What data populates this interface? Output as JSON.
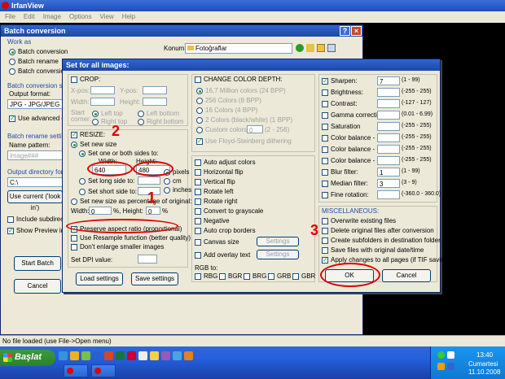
{
  "irfanview": {
    "title": "IrfanView",
    "menu": [
      "File",
      "Edit",
      "Image",
      "Options",
      "View",
      "Help"
    ],
    "status": "No file loaded (use File->Open menu)"
  },
  "batch": {
    "title": "Batch conversion",
    "work_as_label": "Work as",
    "work_as_options": [
      "Batch conversion",
      "Batch rename",
      "Batch conversion -"
    ],
    "settings_label": "Batch conversion setti",
    "output_format_label": "Output format:",
    "output_format_value": "JPG - JPG/JPEG Form",
    "use_advanced_label": "Use advanced optio",
    "rename_settings_label": "Batch rename settings",
    "name_pattern_label": "Name pattern:",
    "name_pattern_value": "image###",
    "output_dir_label": "Output directory for resu",
    "output_dir_value": "C:\\",
    "use_current_label": "Use current ('look in')",
    "include_subdirs_label": "Include subdirectories",
    "show_preview_label": "Show Preview imag",
    "start_batch_label": "Start Batch",
    "cancel_label": "Cancel",
    "konum_label": "Konum:",
    "konum_value": "Fotoğraflar"
  },
  "dialog": {
    "title": "Set for all images:",
    "crop": {
      "label": "CROP:",
      "xpos": "X-pos:",
      "ypos": "Y-pos:",
      "width": "Width:",
      "height": "Height:",
      "start_corner": "Start corner:",
      "corners": [
        "Left top",
        "Left bottom",
        "Right top",
        "Right bottom"
      ]
    },
    "resize": {
      "label": "RESIZE:",
      "set_new_size": "Set new size",
      "set_one_or_both": "Set one or both sides to:",
      "width_label": "Width:",
      "height_label": "Height:",
      "width_value": "640",
      "height_value": "480",
      "units": [
        "pixels",
        "cm",
        "inches"
      ],
      "set_long_side": "Set long side to:",
      "set_short_side": "Set short side to:",
      "set_as_percentage": "Set new size as percentage of original:",
      "pct_width_label": "Width:",
      "pct_height_label": "%, Height:",
      "pct_width_value": "0",
      "pct_height_value": "0",
      "pct_symbol": "%",
      "preserve_aspect": "Preserve aspect ratio (proportional)",
      "use_resample": "Use Resample function (better quality)",
      "dont_enlarge": "Don't enlarge smaller images",
      "set_dpi": "Set DPI value:"
    },
    "load_settings": "Load settings",
    "save_settings": "Save settings",
    "color_depth": {
      "label": "CHANGE COLOR DEPTH:",
      "options": [
        "16,7 Million colors (24 BPP)",
        "256 Colors (8 BPP)",
        "16 Colors (4 BPP)",
        "2 Colors (black/white) (1 BPP)",
        "Custom colors:"
      ],
      "custom_range": "(2 - 256)",
      "custom_value": "0",
      "floyd": "Use Floyd-Steinberg dithering"
    },
    "transforms": [
      "Auto adjust colors",
      "Horizontal flip",
      "Vertical flip",
      "Rotate left",
      "Rotate right",
      "Convert to grayscale",
      "Negative",
      "Auto crop borders",
      "Canvas size",
      "Add overlay text"
    ],
    "settings_btn": "Settings",
    "rgb_label": "RGB to:",
    "rgb_options": [
      "RBG",
      "BGR",
      "BRG",
      "GRB",
      "GBR"
    ],
    "adjust": [
      {
        "label": "Sharpen:",
        "value": "7",
        "range": "(1 - 99)",
        "checked": true
      },
      {
        "label": "Brightness:",
        "value": "",
        "range": "(-255 - 255)",
        "checked": false
      },
      {
        "label": "Contrast:",
        "value": "",
        "range": "(-127 - 127)",
        "checked": false
      },
      {
        "label": "Gamma correction:",
        "value": "",
        "range": "(0.01 - 6.99)",
        "checked": false
      },
      {
        "label": "Saturation",
        "value": "",
        "range": "(-255 - 255)",
        "checked": false
      },
      {
        "label": "Color balance - R:",
        "value": "",
        "range": "(-255 - 255)",
        "checked": false
      },
      {
        "label": "Color balance - G:",
        "value": "",
        "range": "(-255 - 255)",
        "checked": false
      },
      {
        "label": "Color balance - B:",
        "value": "",
        "range": "(-255 - 255)",
        "checked": false
      },
      {
        "label": "Blur filter:",
        "value": "1",
        "range": "(1 - 99)",
        "checked": false
      },
      {
        "label": "Median filter:",
        "value": "3",
        "range": "(3 - 9)",
        "checked": false
      },
      {
        "label": "Fine rotation:",
        "value": "",
        "range": "(-360.0 - 360.0)",
        "checked": false
      }
    ],
    "misc": {
      "label": "MISCELLANEOUS:",
      "options": [
        "Overwrite existing files",
        "Delete original files after conversion",
        "Create subfolders in destination folder",
        "Save files with original date/time",
        "Apply changes to all pages (if TIF saving)"
      ]
    },
    "ok": "OK",
    "cancel": "Cancel"
  },
  "annotations": {
    "one": "1",
    "two": "2",
    "three": "3"
  },
  "taskbar": {
    "start": "Başlat",
    "time": "13:40",
    "day": "Cumartesi",
    "date": "11.10.2008"
  }
}
